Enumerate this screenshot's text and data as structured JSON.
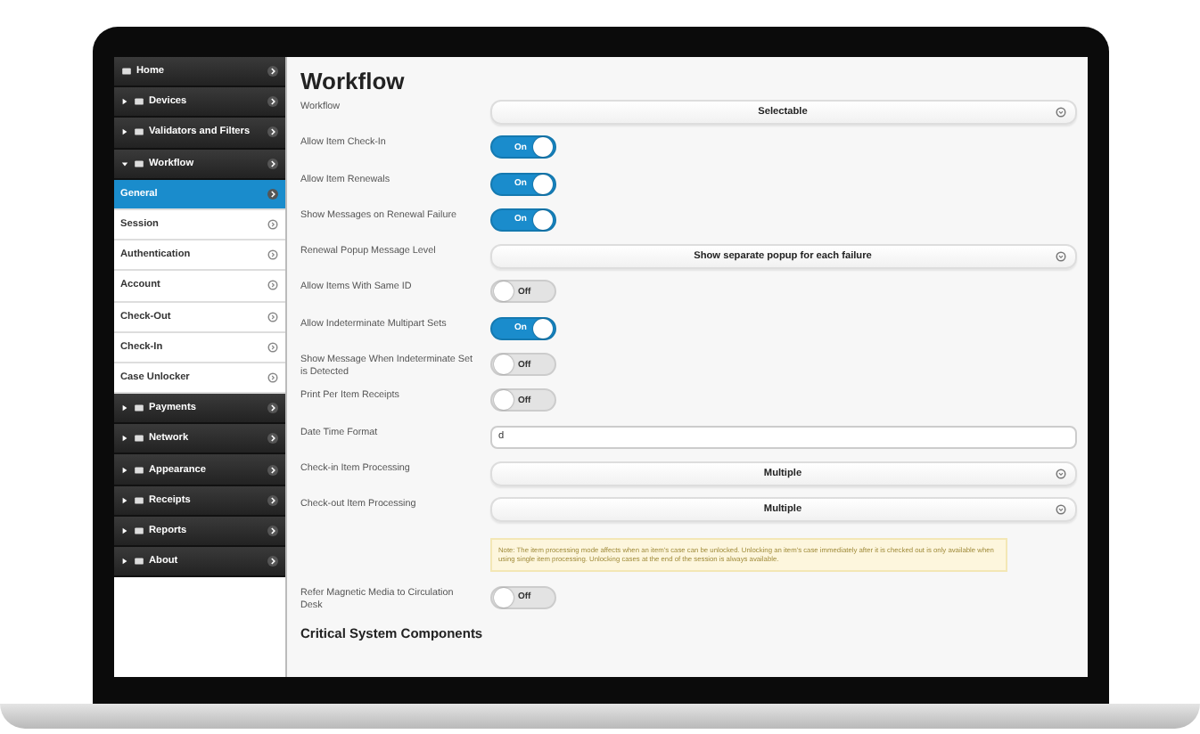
{
  "sidebar": {
    "items": [
      {
        "kind": "link",
        "label": "Home",
        "selected": false
      },
      {
        "kind": "section",
        "label": "Devices",
        "expanded": false,
        "selected": false
      },
      {
        "kind": "section",
        "label": "Validators and Filters",
        "expanded": false,
        "selected": false
      },
      {
        "kind": "section",
        "label": "Workflow",
        "expanded": true,
        "selected": false,
        "children": [
          {
            "label": "General",
            "selected": true
          },
          {
            "label": "Session",
            "selected": false
          },
          {
            "label": "Authentication",
            "selected": false
          },
          {
            "label": "Account",
            "selected": false
          },
          {
            "label": "Check-Out",
            "selected": false
          },
          {
            "label": "Check-In",
            "selected": false
          },
          {
            "label": "Case Unlocker",
            "selected": false
          }
        ]
      },
      {
        "kind": "section",
        "label": "Payments",
        "expanded": false,
        "selected": false
      },
      {
        "kind": "section",
        "label": "Network",
        "expanded": false,
        "selected": false
      },
      {
        "kind": "section",
        "label": "Appearance",
        "expanded": false,
        "selected": false
      },
      {
        "kind": "section",
        "label": "Receipts",
        "expanded": false,
        "selected": false
      },
      {
        "kind": "section",
        "label": "Reports",
        "expanded": false,
        "selected": false
      },
      {
        "kind": "section",
        "label": "About",
        "expanded": false,
        "selected": false
      }
    ]
  },
  "content": {
    "title": "Workflow",
    "settings": [
      {
        "kind": "select",
        "label": "Workflow",
        "value": "Selectable"
      },
      {
        "kind": "toggle",
        "label": "Allow Item Check-In",
        "on": true,
        "state_text": "On"
      },
      {
        "kind": "toggle",
        "label": "Allow Item Renewals",
        "on": true,
        "state_text": "On"
      },
      {
        "kind": "toggle",
        "label": "Show Messages on Renewal Failure",
        "on": true,
        "state_text": "On"
      },
      {
        "kind": "select",
        "label": "Renewal Popup Message Level",
        "value": "Show separate popup for each failure"
      },
      {
        "kind": "toggle",
        "label": "Allow Items With Same ID",
        "on": false,
        "state_text": "Off"
      },
      {
        "kind": "toggle",
        "label": "Allow Indeterminate Multipart Sets",
        "on": true,
        "state_text": "On"
      },
      {
        "kind": "toggle",
        "label": "Show Message When Indeterminate Set is Detected",
        "on": false,
        "state_text": "Off"
      },
      {
        "kind": "toggle",
        "label": "Print Per Item Receipts",
        "on": false,
        "state_text": "Off"
      },
      {
        "kind": "text",
        "label": "Date Time Format",
        "value": "d"
      },
      {
        "kind": "select",
        "label": "Check-in Item Processing",
        "value": "Multiple"
      },
      {
        "kind": "select",
        "label": "Check-out Item Processing",
        "value": "Multiple"
      },
      {
        "kind": "note",
        "text": "Note: The item processing mode affects when an item's case can be unlocked. Unlocking an item's case immediately after it is checked out is only available when using single item processing. Unlocking cases at the end of the session is always available."
      },
      {
        "kind": "toggle",
        "label": "Refer Magnetic Media to Circulation Desk",
        "on": false,
        "state_text": "Off"
      }
    ],
    "section_heading": "Critical System Components"
  }
}
